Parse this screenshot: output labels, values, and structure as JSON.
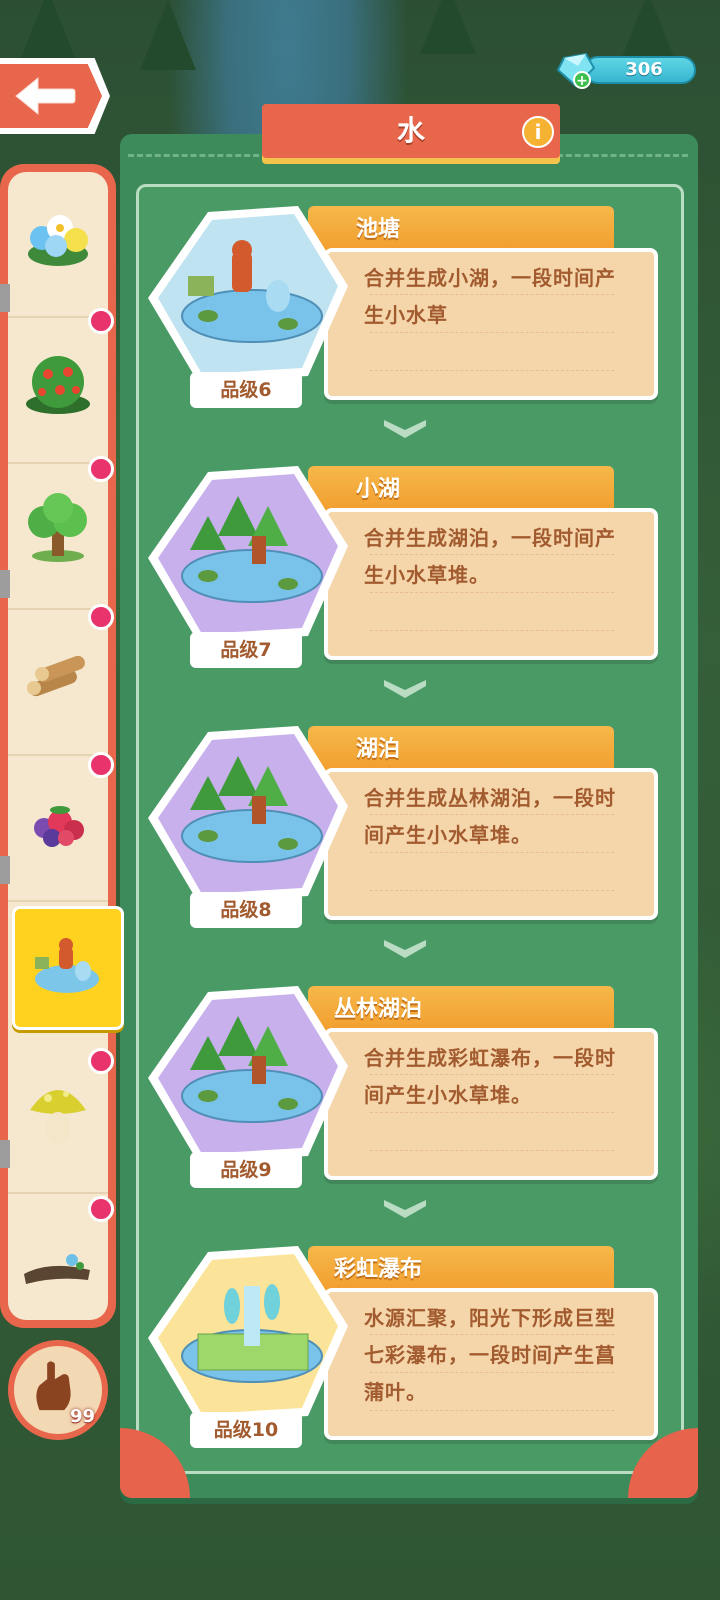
{
  "header": {
    "title": "水",
    "info_label": "i",
    "gems": "306",
    "gem_plus": "+"
  },
  "sidebar": {
    "items": [
      {
        "name": "flowers"
      },
      {
        "name": "berry-bush"
      },
      {
        "name": "tree"
      },
      {
        "name": "logs"
      },
      {
        "name": "berries"
      },
      {
        "name": "water",
        "active": true
      },
      {
        "name": "mushroom"
      },
      {
        "name": "driftwood"
      }
    ],
    "hand_count": "99"
  },
  "cards": [
    {
      "name": "池塘",
      "desc": "合并生成小湖，一段时间产生小水草",
      "grade": "品级6",
      "bg": "#bfe3f0"
    },
    {
      "name": "小湖",
      "desc": "合并生成湖泊，一段时间产生小水草堆。",
      "grade": "品级7",
      "bg": "#c7b0ec"
    },
    {
      "name": "湖泊",
      "desc": "合并生成丛林湖泊，一段时间产生小水草堆。",
      "grade": "品级8",
      "bg": "#c7b0ec"
    },
    {
      "name": "丛林湖泊",
      "desc": "合并生成彩虹瀑布，一段时间产生小水草堆。",
      "grade": "品级9",
      "bg": "#c7b0ec"
    },
    {
      "name": "彩虹瀑布",
      "desc": "水源汇聚，阳光下形成巨型七彩瀑布，一段时间产生菖蒲叶。",
      "grade": "品级10",
      "bg": "#fbe49a"
    }
  ]
}
